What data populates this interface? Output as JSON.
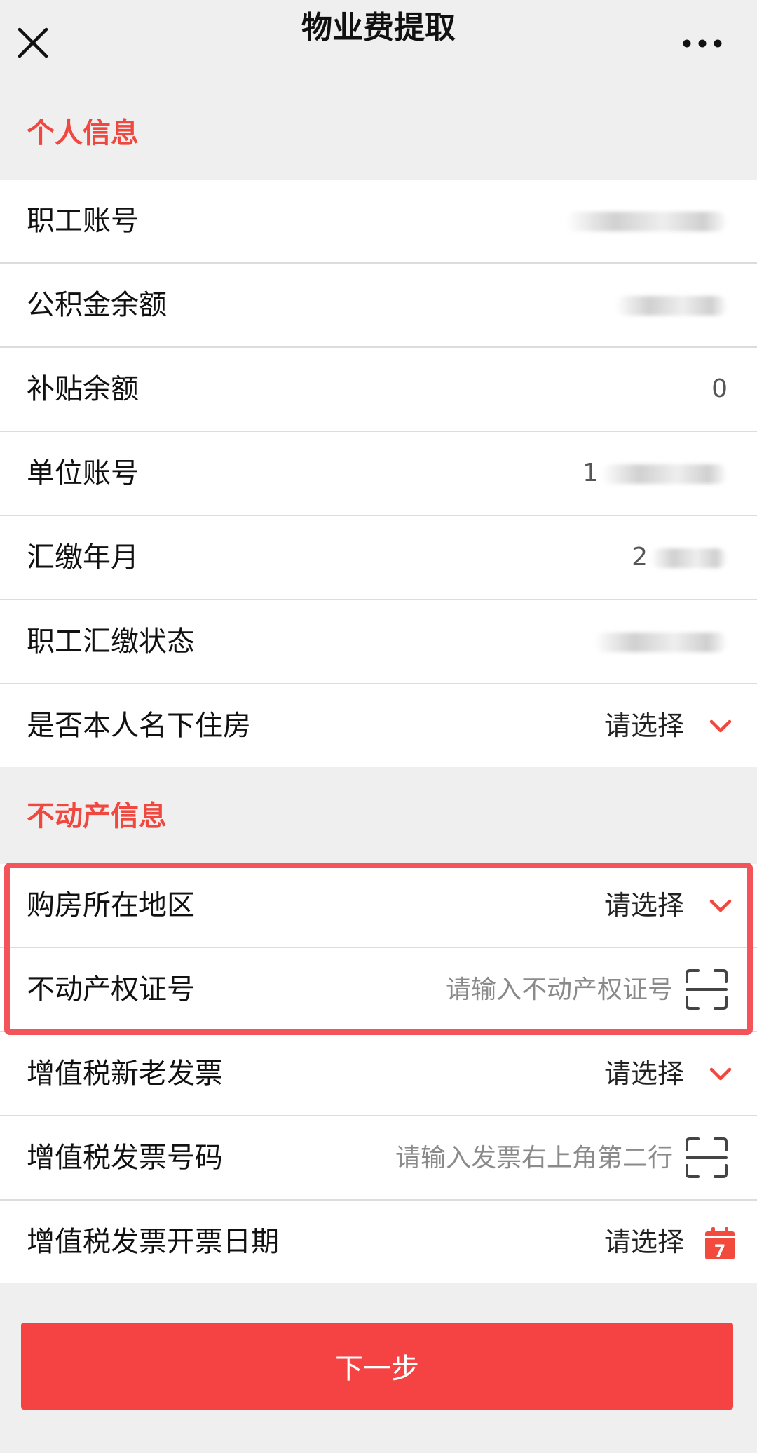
{
  "nav": {
    "title": "物业费提取"
  },
  "colors": {
    "accent": "#f54242",
    "section_title": "#f0473f",
    "highlight": "#f2545a",
    "calendar": "#f24a3c"
  },
  "sections": {
    "personal": {
      "title": "个人信息",
      "rows": [
        {
          "label": "职工账号",
          "value": ""
        },
        {
          "label": "公积金余额",
          "value": ""
        },
        {
          "label": "补贴余额",
          "value": "0"
        },
        {
          "label": "单位账号",
          "value": "1"
        },
        {
          "label": "汇缴年月",
          "value": "2"
        },
        {
          "label": "职工汇缴状态",
          "value": ""
        },
        {
          "label": "是否本人名下住房",
          "value": "请选择"
        }
      ]
    },
    "property": {
      "title": "不动产信息",
      "rows": [
        {
          "label": "购房所在地区",
          "value": "请选择"
        },
        {
          "label": "不动产权证号",
          "placeholder": "请输入不动产权证号"
        },
        {
          "label": "增值税新老发票",
          "value": "请选择"
        },
        {
          "label": "增值税发票号码",
          "placeholder": "请输入发票右上角第二行"
        },
        {
          "label": "增值税发票开票日期",
          "value": "请选择"
        }
      ]
    }
  },
  "calendar_icon_day": "7",
  "footer": {
    "next_label": "下一步"
  },
  "icons": [
    "close-icon",
    "more-icon",
    "chevron-down-icon",
    "scan-icon",
    "calendar-icon"
  ]
}
